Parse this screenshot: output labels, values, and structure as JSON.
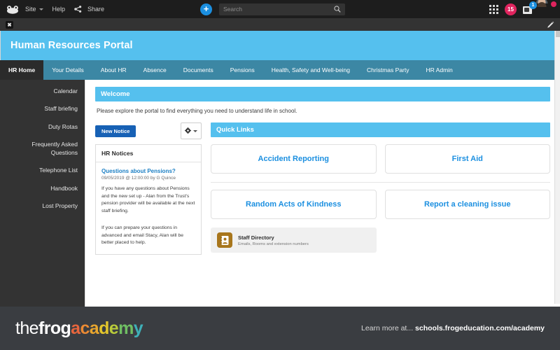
{
  "topbar": {
    "logo_name": "frog-logo",
    "site_label": "Site",
    "help_label": "Help",
    "share_label": "Share",
    "plus_label": "+",
    "search": {
      "placeholder": "Search",
      "value": ""
    },
    "notifications_count": "15",
    "messages_count": "1",
    "accent_blue": "#1b8fe0",
    "badge_red": "#e0245e"
  },
  "subbar": {
    "close_label": "✖",
    "edit_label": "edit"
  },
  "banner": {
    "title": "Human Resources Portal",
    "color": "#55c0ee"
  },
  "nav": {
    "tabs": [
      {
        "label": "HR Home",
        "active": true
      },
      {
        "label": "Your Details",
        "active": false
      },
      {
        "label": "About HR",
        "active": false
      },
      {
        "label": "Absence",
        "active": false
      },
      {
        "label": "Documents",
        "active": false
      },
      {
        "label": "Pensions",
        "active": false
      },
      {
        "label": "Health, Safety and Well-being",
        "active": false
      },
      {
        "label": "Christmas Party",
        "active": false
      },
      {
        "label": "HR Admin",
        "active": false
      }
    ]
  },
  "sidebar": {
    "items": [
      {
        "label": "Calendar"
      },
      {
        "label": "Staff briefing"
      },
      {
        "label": "Duty Rotas"
      },
      {
        "label": "Frequently Asked Questions"
      },
      {
        "label": "Telephone List"
      },
      {
        "label": "Handbook"
      },
      {
        "label": "Lost Property"
      }
    ]
  },
  "welcome": {
    "heading": "Welcome",
    "text": "Please explore the portal to find everything you need to understand life in school."
  },
  "notices": {
    "new_notice_label": "New Notice",
    "panel_title": "HR Notices",
    "item": {
      "title": "Questions about Pensions?",
      "meta": "09/05/2019 @ 12:00:00 by G Quince",
      "paragraph1": "If you have any questions about Pensions and the new set up - Alan from the Trust's pension provider will be available at the next staff briefing.",
      "paragraph2": "If you can prepare your questions in advanced and email Stacy, Alan will be better placed to help."
    }
  },
  "quick_links": {
    "heading": "Quick Links",
    "tiles": [
      {
        "label": "Accident Reporting"
      },
      {
        "label": "First Aid"
      },
      {
        "label": "Random Acts of Kindness"
      },
      {
        "label": "Report a cleaning issue"
      }
    ],
    "staff_directory": {
      "title": "Staff Directory",
      "subtitle": "Emails, Rooms and extension numbers",
      "icon_color": "#a8761c"
    }
  },
  "footer": {
    "logo_the": "the",
    "logo_frog": "frog",
    "logo_academy_letters": [
      {
        "ch": "a",
        "color": "#e8663d"
      },
      {
        "ch": "c",
        "color": "#eb8a33"
      },
      {
        "ch": "a",
        "color": "#e8a62e"
      },
      {
        "ch": "d",
        "color": "#e2c52c"
      },
      {
        "ch": "e",
        "color": "#b9cb3a"
      },
      {
        "ch": "m",
        "color": "#6fbf63"
      },
      {
        "ch": "y",
        "color": "#3fb0b8"
      }
    ],
    "learn_more_prefix": "Learn more at... ",
    "learn_more_url": "schools.frogeducation.com/academy"
  }
}
